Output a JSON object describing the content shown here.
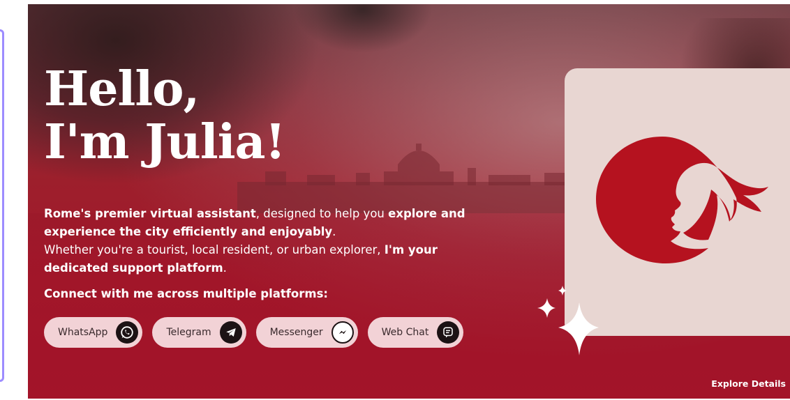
{
  "hero": {
    "title_line1": "Hello,",
    "title_line2": "I'm Julia!",
    "desc": {
      "p1_bold1": "Rome's premier virtual assistant",
      "p1_text1": ", designed to help you ",
      "p1_bold2": "explore and experience the city efficiently and enjoyably",
      "p1_text2": ".",
      "p2_text1": "Whether you're a tourist, local resident, or urban explorer, ",
      "p2_bold1": "I'm your dedicated support platform",
      "p2_text2": "."
    },
    "connect_label": "Connect with me across multiple platforms:",
    "platforms": [
      {
        "label": "WhatsApp",
        "icon": "whatsapp-icon"
      },
      {
        "label": "Telegram",
        "icon": "telegram-icon"
      },
      {
        "label": "Messenger",
        "icon": "messenger-icon"
      },
      {
        "label": "Web Chat",
        "icon": "chat-icon"
      }
    ],
    "explore_label": "Explore Details"
  },
  "colors": {
    "hero_red": "#a3172a",
    "card_bg": "#e8d6d2",
    "logo_red": "#b5121f",
    "pill_bg": "#f2d2d6",
    "side_frame": "#9d8cff"
  },
  "icons": [
    "julia-logo-icon",
    "sparkle-icon"
  ]
}
